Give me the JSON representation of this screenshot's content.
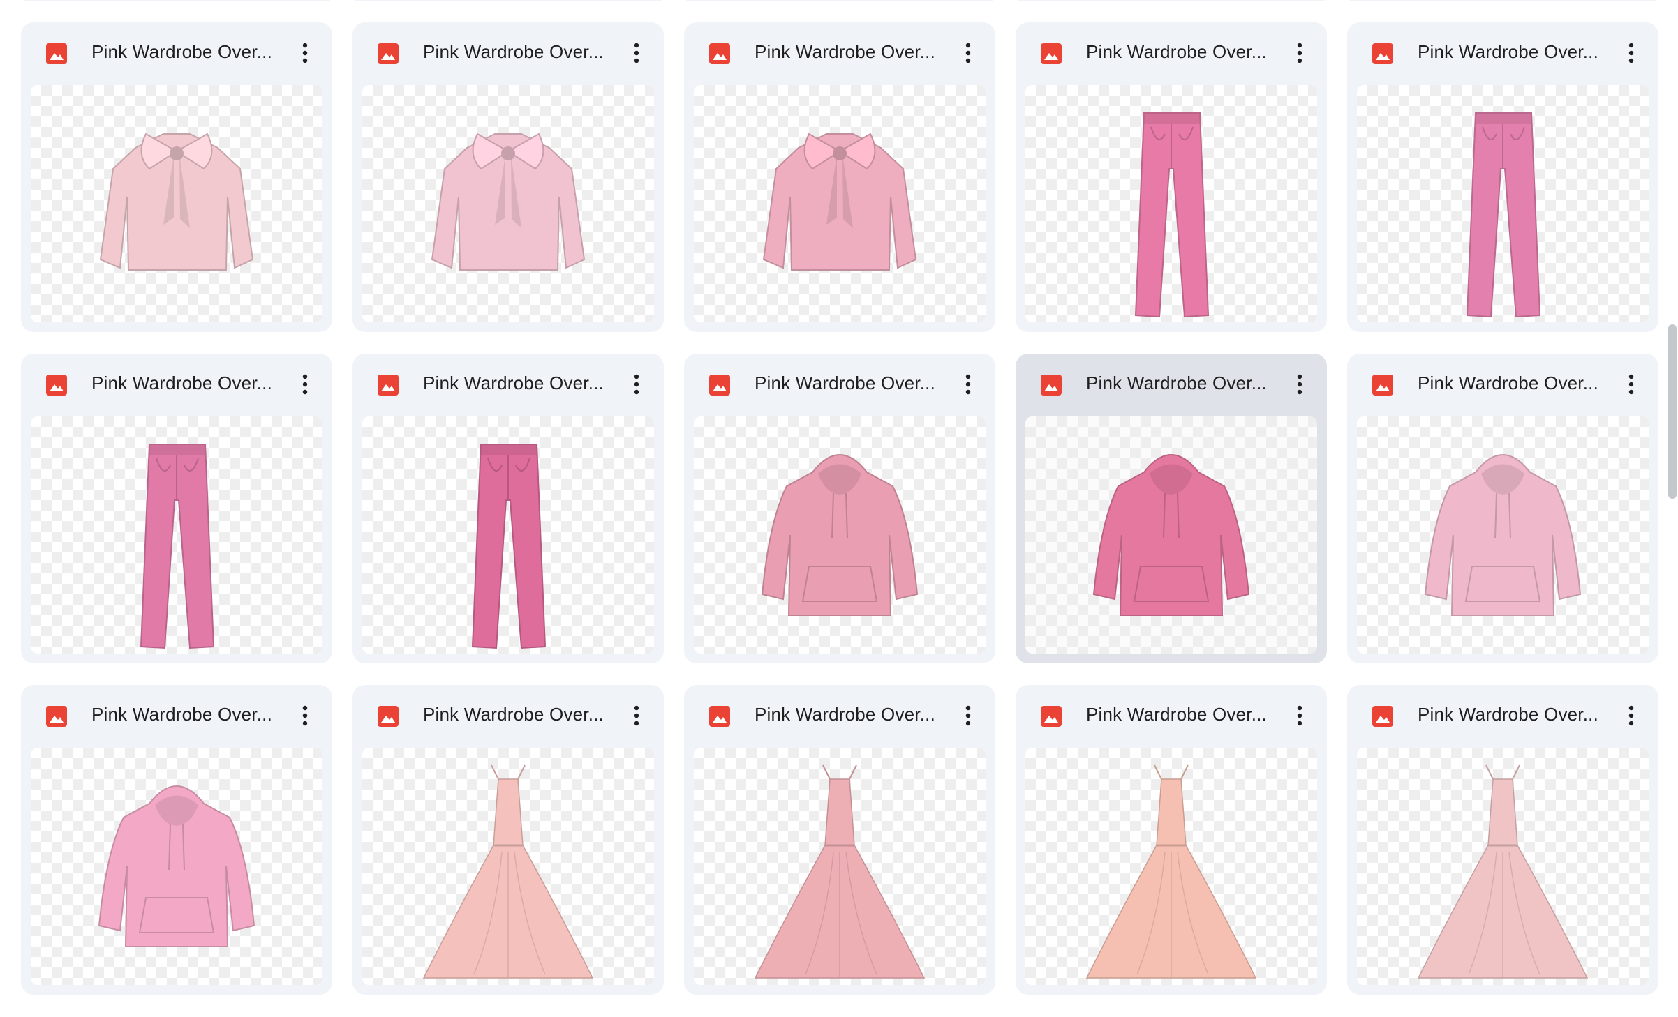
{
  "files": [
    {
      "name": "Pink Wardrobe Over...",
      "type": "blouse",
      "color": "#f2c9cf"
    },
    {
      "name": "Pink Wardrobe Over...",
      "type": "blouse",
      "color": "#f1c3d0"
    },
    {
      "name": "Pink Wardrobe Over...",
      "type": "blouse",
      "color": "#eeaebf"
    },
    {
      "name": "Pink Wardrobe Over...",
      "type": "pants",
      "color": "#e77aa6"
    },
    {
      "name": "Pink Wardrobe Over...",
      "type": "pants",
      "color": "#e480ad"
    },
    {
      "name": "Pink Wardrobe Over...",
      "type": "pants",
      "color": "#e27aa8"
    },
    {
      "name": "Pink Wardrobe Over...",
      "type": "pants",
      "color": "#de6d9c"
    },
    {
      "name": "Pink Wardrobe Over...",
      "type": "hoodie",
      "color": "#e99eb2"
    },
    {
      "name": "Pink Wardrobe Over...",
      "type": "hoodie",
      "color": "#e5789f",
      "selected": true
    },
    {
      "name": "Pink Wardrobe Over...",
      "type": "hoodie",
      "color": "#efb9cb"
    },
    {
      "name": "Pink Wardrobe Over...",
      "type": "hoodie",
      "color": "#f3a9c6"
    },
    {
      "name": "Pink Wardrobe Over...",
      "type": "gown",
      "color": "#f4c1bc"
    },
    {
      "name": "Pink Wardrobe Over...",
      "type": "gown",
      "color": "#eeafb4"
    },
    {
      "name": "Pink Wardrobe Over...",
      "type": "gown",
      "color": "#f5c0b1"
    },
    {
      "name": "Pink Wardrobe Over...",
      "type": "gown",
      "color": "#f0c3c4"
    }
  ],
  "colors": {
    "card_bg": "#f0f4f9",
    "card_selected_bg": "#dfe3e9",
    "image_icon": "#ea4335",
    "text": "#1f1f1f"
  },
  "icons": {
    "file_type": "image-file-icon",
    "more": "more-vert-icon"
  }
}
